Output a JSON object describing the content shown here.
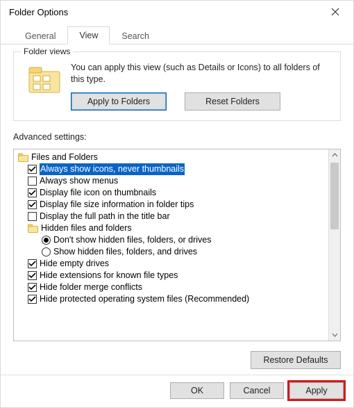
{
  "window": {
    "title": "Folder Options"
  },
  "tabs": {
    "general": "General",
    "view": "View",
    "search": "Search"
  },
  "folderViews": {
    "legend": "Folder views",
    "text": "You can apply this view (such as Details or Icons) to all folders of this type.",
    "apply": "Apply to Folders",
    "reset": "Reset Folders"
  },
  "advanced": {
    "label": "Advanced settings:",
    "root": "Files and Folders",
    "items": {
      "alwaysIcons": "Always show icons, never thumbnails",
      "alwaysMenus": "Always show menus",
      "fileIconThumb": "Display file icon on thumbnails",
      "fileSizeTips": "Display file size information in folder tips",
      "fullPathTitle": "Display the full path in the title bar",
      "hiddenGroup": "Hidden files and folders",
      "dontShowHidden": "Don't show hidden files, folders, or drives",
      "showHidden": "Show hidden files, folders, and drives",
      "hideEmpty": "Hide empty drives",
      "hideExt": "Hide extensions for known file types",
      "hideMerge": "Hide folder merge conflicts",
      "hideProtected": "Hide protected operating system files (Recommended)"
    }
  },
  "restore": "Restore Defaults",
  "footer": {
    "ok": "OK",
    "cancel": "Cancel",
    "apply": "Apply"
  }
}
